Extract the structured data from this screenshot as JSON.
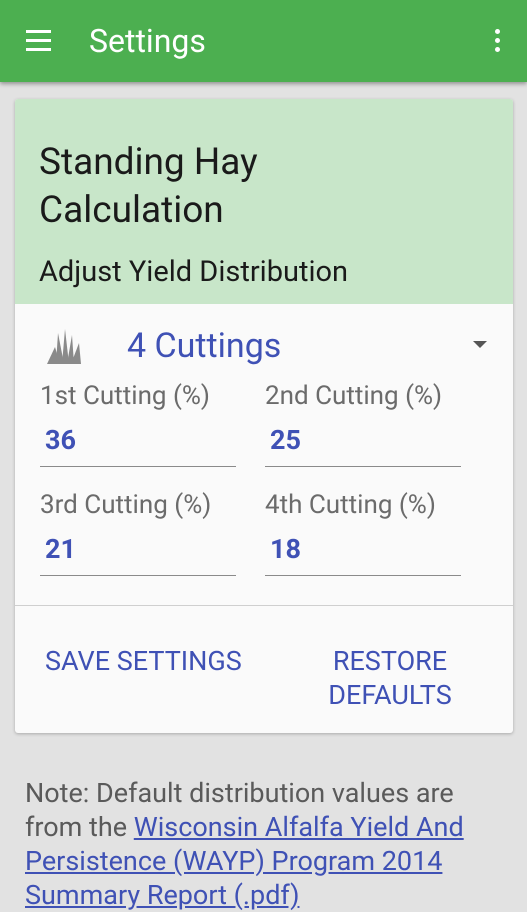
{
  "app_bar": {
    "title": "Settings",
    "menu_icon": "hamburger-menu-icon",
    "overflow_icon": "more-vert-icon",
    "color": "#4caf50"
  },
  "card": {
    "title": "Standing Hay Calculation",
    "subtitle": "Adjust Yield Distribution",
    "header_color": "#c8e6c9",
    "crop_icon": "grass-icon",
    "cuttings_select": {
      "value": "4 Cuttings"
    },
    "fields": [
      {
        "label": "1st Cutting (%)",
        "value": "36"
      },
      {
        "label": "2nd Cutting (%)",
        "value": "25"
      },
      {
        "label": "3rd Cutting (%)",
        "value": "21"
      },
      {
        "label": "4th Cutting (%)",
        "value": "18"
      }
    ],
    "actions": {
      "save_label": "SAVE SETTINGS",
      "restore_label": "RESTORE DEFAULTS"
    },
    "accent_color": "#3f51b5"
  },
  "note": {
    "prefix": "Note: Default distribution values are from the ",
    "link_text": "Wisconsin Alfalfa Yield And Persistence (WAYP) Program 2014 Summary Report (.pdf)"
  }
}
